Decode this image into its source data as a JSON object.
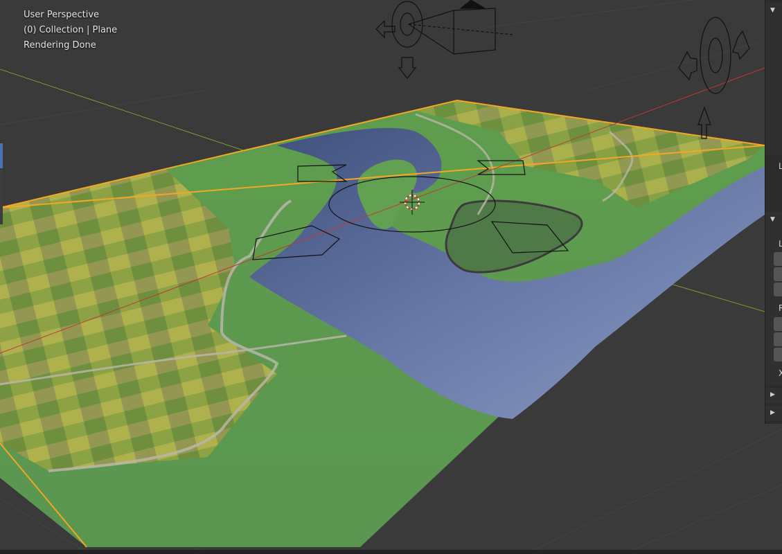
{
  "viewport": {
    "view_name": "User Perspective",
    "collection_info": "(0) Collection | Plane",
    "status": "Rendering Done"
  },
  "side_panel": {
    "sections": [
      {
        "arrow": "▼",
        "letter": ""
      },
      {
        "arrow": "",
        "letter": "L"
      },
      {
        "arrow": "▼",
        "letter": ""
      },
      {
        "arrow": "",
        "letter": "L"
      },
      {
        "arrow": "",
        "letter": "R"
      },
      {
        "arrow": "",
        "letter": "X"
      },
      {
        "arrow": "▶",
        "letter": ""
      },
      {
        "arrow": "▶",
        "letter": ""
      }
    ]
  },
  "colors": {
    "background": "#3a3a3a",
    "selection_outline": "#f5a623",
    "x_axis": "#c03838",
    "y_axis": "#7a9a30",
    "water": "#4a5c8a",
    "grass": "#5a9a4a",
    "fields": "#a8b04a"
  }
}
